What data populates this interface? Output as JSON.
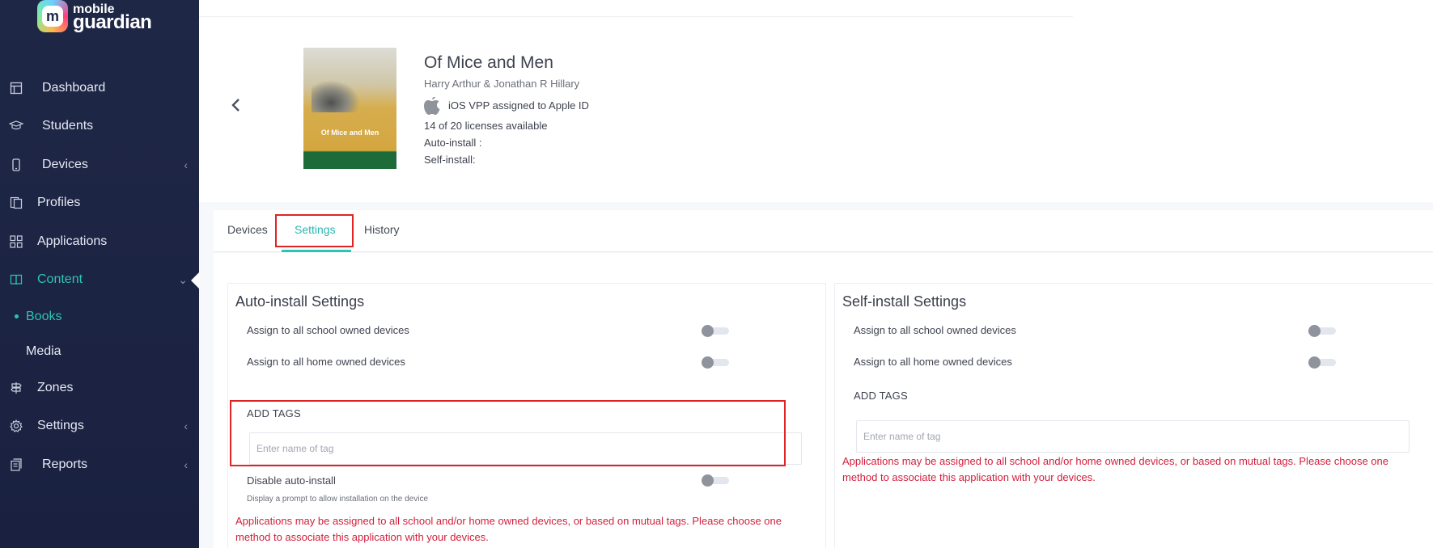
{
  "brand": {
    "line1": "mobile",
    "line2": "guardian",
    "mark": "m"
  },
  "sidebar": {
    "items": [
      {
        "label": "Dashboard",
        "icon": "dashboard-icon"
      },
      {
        "label": "Students",
        "icon": "students-icon"
      },
      {
        "label": "Devices",
        "icon": "devices-icon"
      },
      {
        "label": "Profiles",
        "icon": "profiles-icon"
      },
      {
        "label": "Applications",
        "icon": "applications-icon"
      },
      {
        "label": "Content",
        "icon": "content-icon"
      },
      {
        "label": "Zones",
        "icon": "zones-icon"
      },
      {
        "label": "Settings",
        "icon": "settings-icon"
      },
      {
        "label": "Reports",
        "icon": "reports-icon"
      }
    ],
    "sub_items": [
      {
        "label": "Books"
      },
      {
        "label": "Media"
      }
    ],
    "accent_color": "#2cc4b4"
  },
  "book": {
    "title": "Of Mice and Men",
    "author": "Harry Arthur & Jonathan R Hillary",
    "vpp": "iOS VPP assigned to Apple ID",
    "licenses": "14 of 20 licenses available",
    "auto_install": "Auto-install :",
    "self_install": "Self-install:",
    "cover_text": "Of Mice and Men"
  },
  "tabs": [
    {
      "label": "Devices"
    },
    {
      "label": "Settings"
    },
    {
      "label": "History"
    }
  ],
  "auto": {
    "title": "Auto-install Settings",
    "school": "Assign to all school owned devices",
    "home": "Assign to all home owned devices",
    "tags_label": "ADD TAGS",
    "tags_placeholder": "Enter name of tag",
    "disable": "Disable auto-install",
    "disable_help": "Display a prompt to allow installation on the device",
    "warning": "Applications may be assigned to all school and/or home owned devices, or based on mutual tags. Please choose one method to associate this application with your devices."
  },
  "self": {
    "title": "Self-install Settings",
    "school": "Assign to all school owned devices",
    "home": "Assign to all home owned devices",
    "tags_label": "ADD TAGS",
    "tags_placeholder": "Enter name of tag",
    "warning": "Applications may be assigned to all school and/or home owned devices, or based on mutual tags. Please choose one method to associate this application with your devices."
  },
  "colors": {
    "warning": "#d21f3c",
    "highlight": "#e02424"
  }
}
